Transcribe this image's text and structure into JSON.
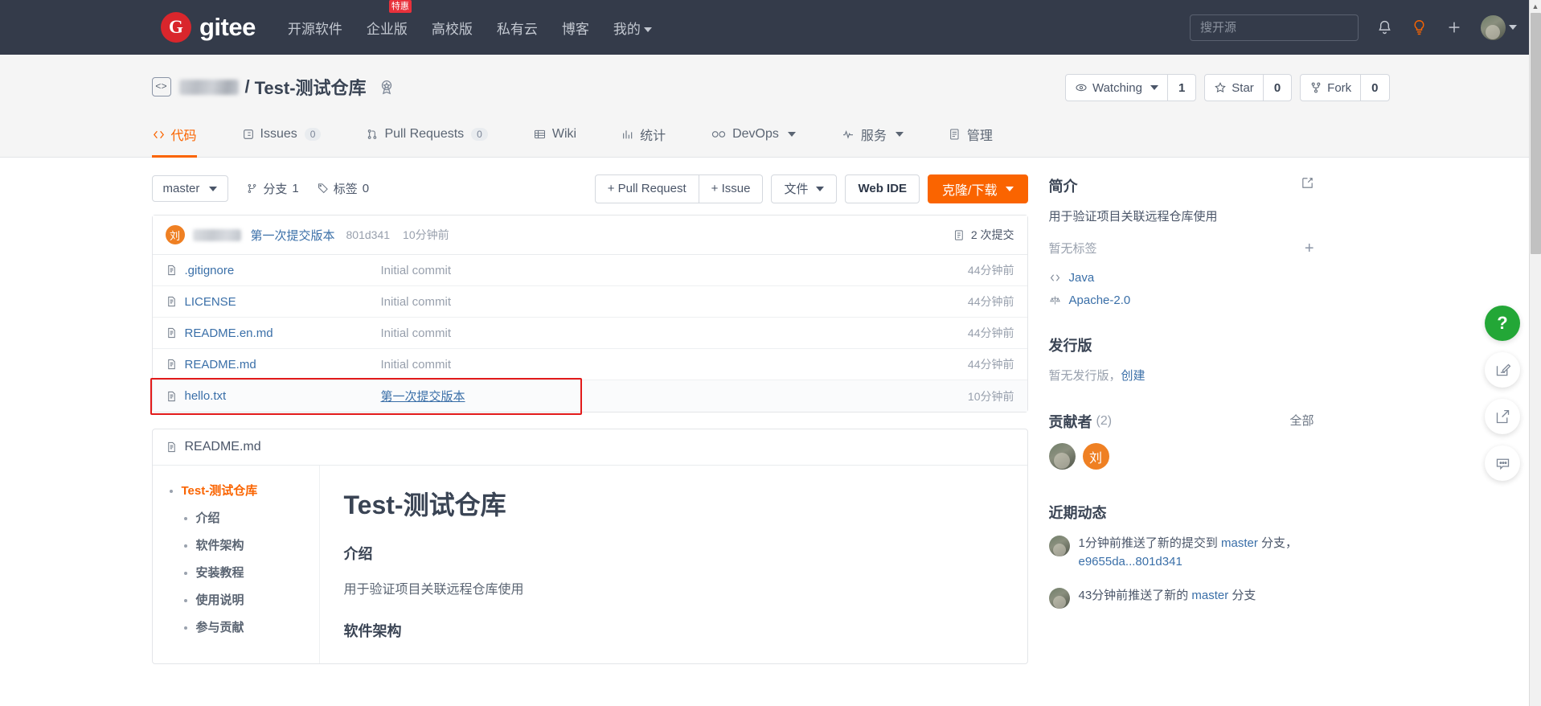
{
  "topnav": {
    "brand_mark": "G",
    "brand_name": "gitee",
    "links": [
      {
        "label": "开源软件",
        "badge": null,
        "caret": false
      },
      {
        "label": "企业版",
        "badge": "特惠",
        "caret": false
      },
      {
        "label": "高校版",
        "badge": null,
        "caret": false
      },
      {
        "label": "私有云",
        "badge": null,
        "caret": false
      },
      {
        "label": "博客",
        "badge": null,
        "caret": false
      },
      {
        "label": "我的",
        "badge": null,
        "caret": true
      }
    ],
    "search_placeholder": "搜开源",
    "icons": [
      "bell-icon",
      "lightbulb-icon",
      "plus-icon",
      "avatar"
    ],
    "accent": "#fa6400",
    "bell_title": "通知",
    "bulb_title": "建议",
    "plus_title": "新建"
  },
  "repo": {
    "owner_redacted": true,
    "separator": "/",
    "name": "Test-测试仓库",
    "badge_icon": "award-badge-icon",
    "watch": {
      "label": "Watching",
      "count": "1"
    },
    "star": {
      "label": "Star",
      "count": "0"
    },
    "fork": {
      "label": "Fork",
      "count": "0"
    },
    "tabs": [
      {
        "label": "代码",
        "icon": "code-icon",
        "count": null,
        "active": true,
        "caret": false
      },
      {
        "label": "Issues",
        "icon": "issue-icon",
        "count": "0",
        "active": false,
        "caret": false
      },
      {
        "label": "Pull Requests",
        "icon": "pr-icon",
        "count": "0",
        "active": false,
        "caret": false
      },
      {
        "label": "Wiki",
        "icon": "book-icon",
        "count": null,
        "active": false,
        "caret": false
      },
      {
        "label": "统计",
        "icon": "chart-icon",
        "count": null,
        "active": false,
        "caret": false
      },
      {
        "label": "DevOps",
        "icon": "infinity-icon",
        "count": null,
        "active": false,
        "caret": true
      },
      {
        "label": "服务",
        "icon": "pulse-icon",
        "count": null,
        "active": false,
        "caret": true
      },
      {
        "label": "管理",
        "icon": "settings-icon",
        "count": null,
        "active": false,
        "caret": false
      }
    ]
  },
  "toolbar": {
    "branch": "master",
    "branches_label": "分支",
    "branches_count": "1",
    "tags_label": "标签",
    "tags_count": "0",
    "pull_request_btn": "+ Pull Request",
    "issue_btn": "+ Issue",
    "files_btn": "文件",
    "web_ide_btn": "Web IDE",
    "clone_btn": "克隆/下载"
  },
  "commit_bar": {
    "avatar_initial": "刘",
    "author_redacted": true,
    "message": "第一次提交版本",
    "sha": "801d341",
    "time": "10分钟前",
    "commits_count_label": "2 次提交"
  },
  "files": [
    {
      "name": ".gitignore",
      "message": "Initial commit",
      "message_link": false,
      "time": "44分钟前",
      "highlight": false
    },
    {
      "name": "LICENSE",
      "message": "Initial commit",
      "message_link": false,
      "time": "44分钟前",
      "highlight": false
    },
    {
      "name": "README.en.md",
      "message": "Initial commit",
      "message_link": false,
      "time": "44分钟前",
      "highlight": false
    },
    {
      "name": "README.md",
      "message": "Initial commit",
      "message_link": false,
      "time": "44分钟前",
      "highlight": false
    },
    {
      "name": "hello.txt",
      "message": "第一次提交版本",
      "message_link": true,
      "time": "10分钟前",
      "highlight": true
    }
  ],
  "highlight_color": "#e21b1b",
  "readme": {
    "filename": "README.md",
    "toc_root": "Test-测试仓库",
    "toc_items": [
      "介绍",
      "软件架构",
      "安装教程",
      "使用说明",
      "参与贡献"
    ],
    "title": "Test-测试仓库",
    "section1_heading": "介绍",
    "section1_body": "用于验证项目关联远程仓库使用",
    "section2_heading": "软件架构"
  },
  "sidebar": {
    "intro_heading": "简介",
    "intro_edit_icon": "edit-icon",
    "intro_text": "用于验证项目关联远程仓库使用",
    "no_tags_text": "暂无标签",
    "add_tag_icon": "plus-icon",
    "language": "Java",
    "license": "Apache-2.0",
    "releases_heading": "发行版",
    "no_releases_text": "暂无发行版，",
    "create_release_link": "创建",
    "contributors_heading": "贡献者",
    "contributors_count": "(2)",
    "contributors_all": "全部",
    "contributor_initial": "刘",
    "activity_heading": "近期动态",
    "activities": [
      {
        "time": "1分钟前",
        "text_before": "推送了新的提交到 ",
        "link1": "master",
        "text_mid": " 分支，",
        "link2": "e9655da...801d341",
        "text_after": ""
      },
      {
        "time": "43分钟前",
        "text_before": "推送了新的 ",
        "link1": "master",
        "text_mid": " 分支",
        "link2": "",
        "text_after": ""
      }
    ]
  },
  "rail": [
    {
      "icon": "help-question-icon",
      "label": "?",
      "style": "green"
    },
    {
      "icon": "feedback-edit-icon",
      "label": "",
      "style": "plain"
    },
    {
      "icon": "share-external-icon",
      "label": "",
      "style": "plain"
    },
    {
      "icon": "comment-icon",
      "label": "",
      "style": "plain"
    }
  ]
}
